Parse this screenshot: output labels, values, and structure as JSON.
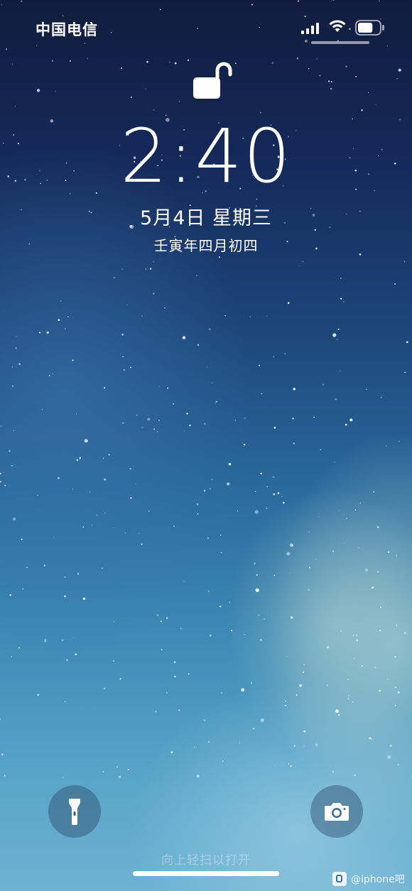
{
  "status_bar": {
    "carrier": "中国电信",
    "icons": [
      "signal-icon",
      "wifi-icon",
      "battery-icon"
    ],
    "battery_level": 0.7
  },
  "lock_state": "unlocked",
  "lock_icon": "unlocked-padlock-icon",
  "clock": {
    "time": "2:40"
  },
  "date": {
    "text": "5月4日 星期三",
    "lunar": "壬寅年四月初四"
  },
  "shortcuts": {
    "left_icon": "flashlight-icon",
    "right_icon": "camera-icon"
  },
  "swipe_hint": "向上轻扫以打开",
  "watermark": "@iphone吧",
  "colors": {
    "sky_top": "#111c3d",
    "sky_bottom": "#6db2d2",
    "text": "#ffffff"
  }
}
